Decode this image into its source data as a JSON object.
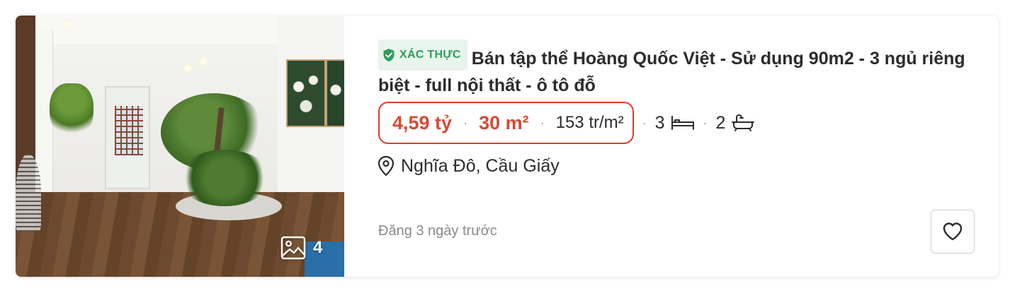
{
  "listing": {
    "photo": {
      "count": "4",
      "icon": "image-icon"
    },
    "badge": {
      "label": "XÁC THỰC",
      "icon": "shield-check-icon",
      "color": "#2f9c5a",
      "background": "#e8f5ec"
    },
    "title": "Bán tập thể Hoàng Quốc Việt - Sử dụng 90m2 - 3 ngủ riêng biệt - full nội thất - ô tô đỗ",
    "price": "4,59 tỷ",
    "area": "30 m²",
    "price_per_m2": "153 tr/m²",
    "bedrooms": "3",
    "bedrooms_icon": "bed-icon",
    "bathrooms": "2",
    "bathrooms_icon": "bathtub-icon",
    "separator": "·",
    "location": "Nghĩa Đô, Cầu Giấy",
    "location_icon": "map-pin-icon",
    "posted": "Đăng 3 ngày trước",
    "favorite_icon": "heart-icon",
    "colors": {
      "price": "#d44b34",
      "highlight_border": "#e03a2f",
      "muted": "#8a8a8a"
    }
  }
}
